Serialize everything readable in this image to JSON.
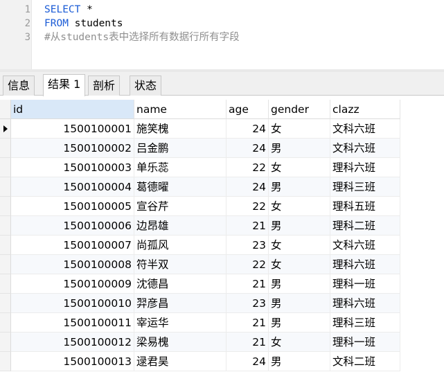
{
  "editor": {
    "lines": [
      {
        "no": "1",
        "keyword": "SELECT",
        "rest": " *",
        "comment": ""
      },
      {
        "no": "2",
        "keyword": "FROM",
        "rest": " students",
        "comment": ""
      },
      {
        "no": "3",
        "keyword": "",
        "rest": "",
        "comment": "#从students表中选择所有数据行所有字段"
      }
    ]
  },
  "tabs": [
    {
      "label": "信息",
      "active": false
    },
    {
      "label": "结果 1",
      "active": true
    },
    {
      "label": "剖析",
      "active": false
    },
    {
      "label": "状态",
      "active": false
    }
  ],
  "grid": {
    "columns": [
      "id",
      "name",
      "age",
      "gender",
      "clazz"
    ],
    "rows": [
      {
        "id": "1500100001",
        "name": "施笑槐",
        "age": "24",
        "gender": "女",
        "clazz": "文科六班"
      },
      {
        "id": "1500100002",
        "name": "吕金鹏",
        "age": "24",
        "gender": "男",
        "clazz": "文科六班"
      },
      {
        "id": "1500100003",
        "name": "单乐蕊",
        "age": "22",
        "gender": "女",
        "clazz": "理科六班"
      },
      {
        "id": "1500100004",
        "name": "葛德曜",
        "age": "24",
        "gender": "男",
        "clazz": "理科三班"
      },
      {
        "id": "1500100005",
        "name": "宣谷芹",
        "age": "22",
        "gender": "女",
        "clazz": "理科五班"
      },
      {
        "id": "1500100006",
        "name": "边昂雄",
        "age": "21",
        "gender": "男",
        "clazz": "理科二班"
      },
      {
        "id": "1500100007",
        "name": "尚孤风",
        "age": "23",
        "gender": "女",
        "clazz": "文科六班"
      },
      {
        "id": "1500100008",
        "name": "符半双",
        "age": "22",
        "gender": "女",
        "clazz": "理科六班"
      },
      {
        "id": "1500100009",
        "name": "沈德昌",
        "age": "21",
        "gender": "男",
        "clazz": "理科一班"
      },
      {
        "id": "1500100010",
        "name": "羿彦昌",
        "age": "23",
        "gender": "男",
        "clazz": "理科六班"
      },
      {
        "id": "1500100011",
        "name": "宰运华",
        "age": "21",
        "gender": "男",
        "clazz": "理科三班"
      },
      {
        "id": "1500100012",
        "name": "梁易槐",
        "age": "21",
        "gender": "女",
        "clazz": "理科一班"
      },
      {
        "id": "1500100013",
        "name": "逯君昊",
        "age": "24",
        "gender": "男",
        "clazz": "文科二班"
      }
    ]
  }
}
